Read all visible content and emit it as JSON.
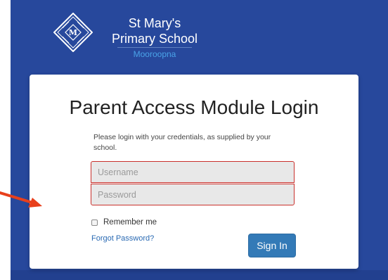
{
  "header": {
    "school_name_line1": "St Mary's",
    "school_name_line2": "Primary School",
    "school_location": "Mooroopna",
    "logo_icon": "school-crest-icon"
  },
  "login": {
    "title": "Parent Access Module Login",
    "intro_text": "Please login with your credentials, as supplied by your school.",
    "username_placeholder": "Username",
    "password_placeholder": "Password",
    "remember_label": "Remember me",
    "forgot_link": "Forgot Password?",
    "signin_label": "Sign In"
  },
  "annotation": {
    "arrow_icon": "red-arrow-icon"
  },
  "colors": {
    "background": "#27489c",
    "button": "#337ab7",
    "field_border": "#c9302c",
    "arrow": "#e8401c",
    "location_text": "#4aa3e8"
  }
}
